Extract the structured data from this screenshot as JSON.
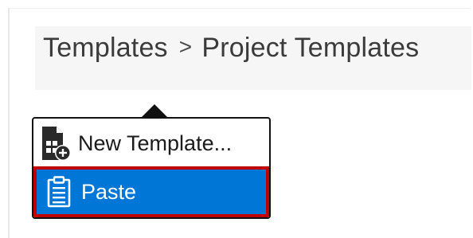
{
  "breadcrumb": {
    "root": "Templates",
    "separator": ">",
    "current": "Project Templates"
  },
  "context_menu": {
    "items": [
      {
        "label": "New Template...",
        "icon": "new-template-icon",
        "selected": false
      },
      {
        "label": "Paste",
        "icon": "clipboard-icon",
        "selected": true
      }
    ]
  },
  "colors": {
    "selected_bg": "#0076d6",
    "selected_border": "#c00000",
    "menu_border": "#111111"
  }
}
